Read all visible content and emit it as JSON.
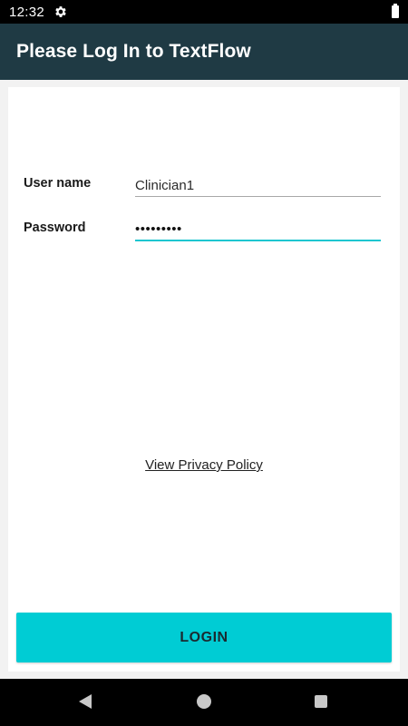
{
  "status_bar": {
    "time": "12:32",
    "settings_icon": "gear-icon",
    "battery_icon": "battery-icon"
  },
  "app_bar": {
    "title": "Please Log In to TextFlow"
  },
  "form": {
    "username_label": "User name",
    "username_value": "Clinician1",
    "password_label": "Password",
    "password_value": "•••••••••"
  },
  "privacy_link": "View Privacy Policy",
  "login_button": "LOGIN",
  "nav_bar": {
    "back_icon": "back-icon",
    "home_icon": "home-icon",
    "recents_icon": "recents-icon"
  },
  "colors": {
    "app_bar": "#1f3a44",
    "accent": "#00ccd4",
    "focused_underline": "#1cc6d0"
  }
}
